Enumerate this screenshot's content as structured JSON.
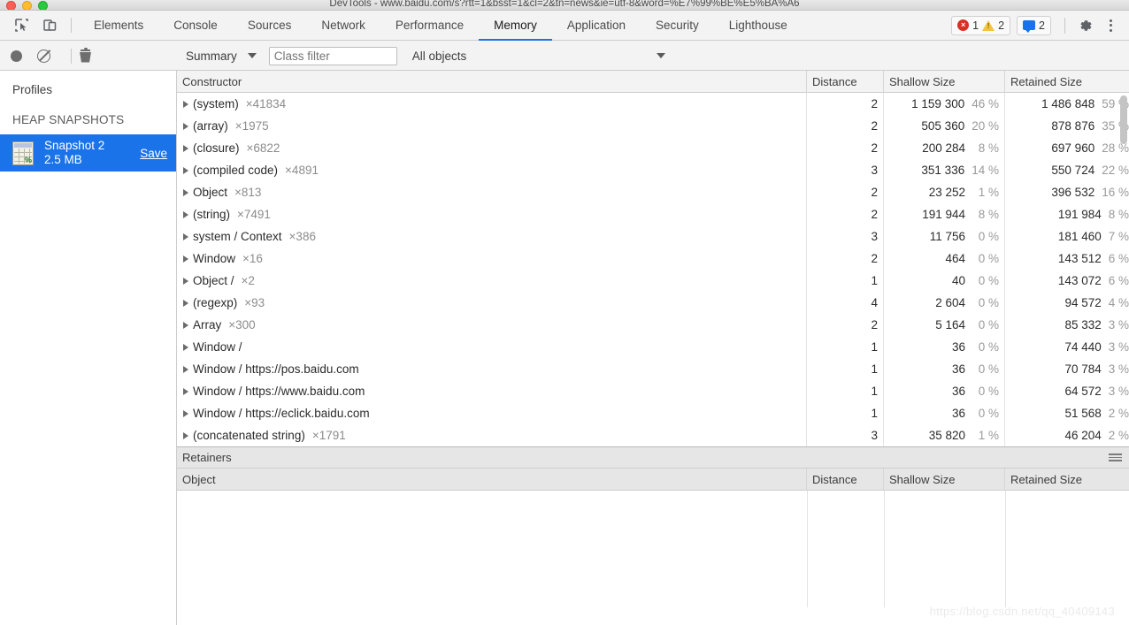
{
  "window": {
    "title": "DevTools - www.baidu.com/s?rtt=1&bsst=1&cl=2&tn=news&ie=utf-8&word=%E7%99%BE%E5%BA%A6"
  },
  "toolbar": {
    "inspect_icon": "inspect-cursor-icon",
    "device_icon": "device-toggle-icon",
    "tabs": [
      {
        "label": "Elements",
        "active": false
      },
      {
        "label": "Console",
        "active": false
      },
      {
        "label": "Sources",
        "active": false
      },
      {
        "label": "Network",
        "active": false
      },
      {
        "label": "Performance",
        "active": false
      },
      {
        "label": "Memory",
        "active": true
      },
      {
        "label": "Application",
        "active": false
      },
      {
        "label": "Security",
        "active": false
      },
      {
        "label": "Lighthouse",
        "active": false
      }
    ],
    "error_count": "1",
    "warning_count": "2",
    "info_count": "2",
    "settings_icon": "gear-icon",
    "more_icon": "kebab-menu-icon",
    "accent_color": "#1a73e8"
  },
  "subtoolbar": {
    "record_icon": "record-dot-icon",
    "clear_icon": "clear-circle-slash-icon",
    "delete_icon": "trash-icon",
    "view_select": "Summary",
    "class_filter_placeholder": "Class filter",
    "class_filter_value": "",
    "objects_select": "All objects"
  },
  "sidebar": {
    "title": "Profiles",
    "section": "HEAP SNAPSHOTS",
    "snapshot": {
      "icon": "heap-snapshot-icon",
      "name": "Snapshot 2",
      "size": "2.5 MB",
      "save_label": "Save"
    }
  },
  "grid": {
    "columns": [
      "Constructor",
      "Distance",
      "Shallow Size",
      "Retained Size"
    ],
    "rows": [
      {
        "constructor": "(system)",
        "count": "×41834",
        "distance": "2",
        "shallow": "1 159 300",
        "shallow_pct": "46 %",
        "retained": "1 486 848",
        "retained_pct": "59 %"
      },
      {
        "constructor": "(array)",
        "count": "×1975",
        "distance": "2",
        "shallow": "505 360",
        "shallow_pct": "20 %",
        "retained": "878 876",
        "retained_pct": "35 %"
      },
      {
        "constructor": "(closure)",
        "count": "×6822",
        "distance": "2",
        "shallow": "200 284",
        "shallow_pct": "8 %",
        "retained": "697 960",
        "retained_pct": "28 %"
      },
      {
        "constructor": "(compiled code)",
        "count": "×4891",
        "distance": "3",
        "shallow": "351 336",
        "shallow_pct": "14 %",
        "retained": "550 724",
        "retained_pct": "22 %"
      },
      {
        "constructor": "Object",
        "count": "×813",
        "distance": "2",
        "shallow": "23 252",
        "shallow_pct": "1 %",
        "retained": "396 532",
        "retained_pct": "16 %"
      },
      {
        "constructor": "(string)",
        "count": "×7491",
        "distance": "2",
        "shallow": "191 944",
        "shallow_pct": "8 %",
        "retained": "191 984",
        "retained_pct": "8 %"
      },
      {
        "constructor": "system / Context",
        "count": "×386",
        "distance": "3",
        "shallow": "11 756",
        "shallow_pct": "0 %",
        "retained": "181 460",
        "retained_pct": "7 %"
      },
      {
        "constructor": "Window",
        "count": "×16",
        "distance": "2",
        "shallow": "464",
        "shallow_pct": "0 %",
        "retained": "143 512",
        "retained_pct": "6 %"
      },
      {
        "constructor": "Object /",
        "count": "×2",
        "distance": "1",
        "shallow": "40",
        "shallow_pct": "0 %",
        "retained": "143 072",
        "retained_pct": "6 %"
      },
      {
        "constructor": "(regexp)",
        "count": "×93",
        "distance": "4",
        "shallow": "2 604",
        "shallow_pct": "0 %",
        "retained": "94 572",
        "retained_pct": "4 %"
      },
      {
        "constructor": "Array",
        "count": "×300",
        "distance": "2",
        "shallow": "5 164",
        "shallow_pct": "0 %",
        "retained": "85 332",
        "retained_pct": "3 %"
      },
      {
        "constructor": "Window /",
        "count": "",
        "distance": "1",
        "shallow": "36",
        "shallow_pct": "0 %",
        "retained": "74 440",
        "retained_pct": "3 %"
      },
      {
        "constructor": "Window / https://pos.baidu.com",
        "count": "",
        "distance": "1",
        "shallow": "36",
        "shallow_pct": "0 %",
        "retained": "70 784",
        "retained_pct": "3 %"
      },
      {
        "constructor": "Window / https://www.baidu.com",
        "count": "",
        "distance": "1",
        "shallow": "36",
        "shallow_pct": "0 %",
        "retained": "64 572",
        "retained_pct": "3 %"
      },
      {
        "constructor": "Window / https://eclick.baidu.com",
        "count": "",
        "distance": "1",
        "shallow": "36",
        "shallow_pct": "0 %",
        "retained": "51 568",
        "retained_pct": "2 %"
      },
      {
        "constructor": "(concatenated string)",
        "count": "×1791",
        "distance": "3",
        "shallow": "35 820",
        "shallow_pct": "1 %",
        "retained": "46 204",
        "retained_pct": "2 %"
      }
    ]
  },
  "retainers": {
    "title": "Retainers",
    "menu_icon": "hamburger-menu-icon",
    "columns": [
      "Object",
      "Distance",
      "Shallow Size",
      "Retained Size"
    ],
    "rows": []
  },
  "watermark": "https://blog.csdn.net/qq_40409143"
}
